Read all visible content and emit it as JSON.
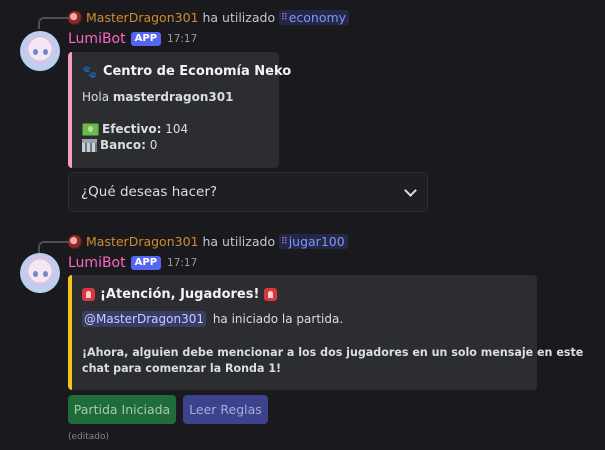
{
  "messages": [
    {
      "reply": {
        "user": "MasterDragon301",
        "action": "ha utilizado",
        "command": "economy"
      },
      "author": "LumiBot",
      "badge": "APP",
      "time": "17:17",
      "embed": {
        "accent": "#f0a0b8",
        "title": "Centro de Economía Neko",
        "greeting_prefix": "Hola",
        "greeting_user": "masterdragon301",
        "cash_label": "Efectivo:",
        "cash_value": "104",
        "bank_label": "Banco:",
        "bank_value": "0"
      },
      "select": {
        "placeholder": "¿Qué deseas hacer?"
      }
    },
    {
      "reply": {
        "user": "MasterDragon301",
        "action": "ha utilizado",
        "command": "jugar100"
      },
      "author": "LumiBot",
      "badge": "APP",
      "time": "17:17",
      "embed": {
        "accent": "#f5c518",
        "title": "¡Atención, Jugadores!",
        "mention": "@MasterDragon301",
        "started_text": "ha iniciado la partida.",
        "instruction_line1": "¡Ahora, alguien debe mencionar a los dos jugadores en un solo mensaje en este",
        "instruction_line2": "chat para comenzar la Ronda 1!"
      },
      "buttons": [
        {
          "label": "Partida Iniciada",
          "color": "#1f6b3a"
        },
        {
          "label": "Leer Reglas",
          "color": "#3c438c"
        }
      ],
      "edited": "(editado)"
    }
  ]
}
